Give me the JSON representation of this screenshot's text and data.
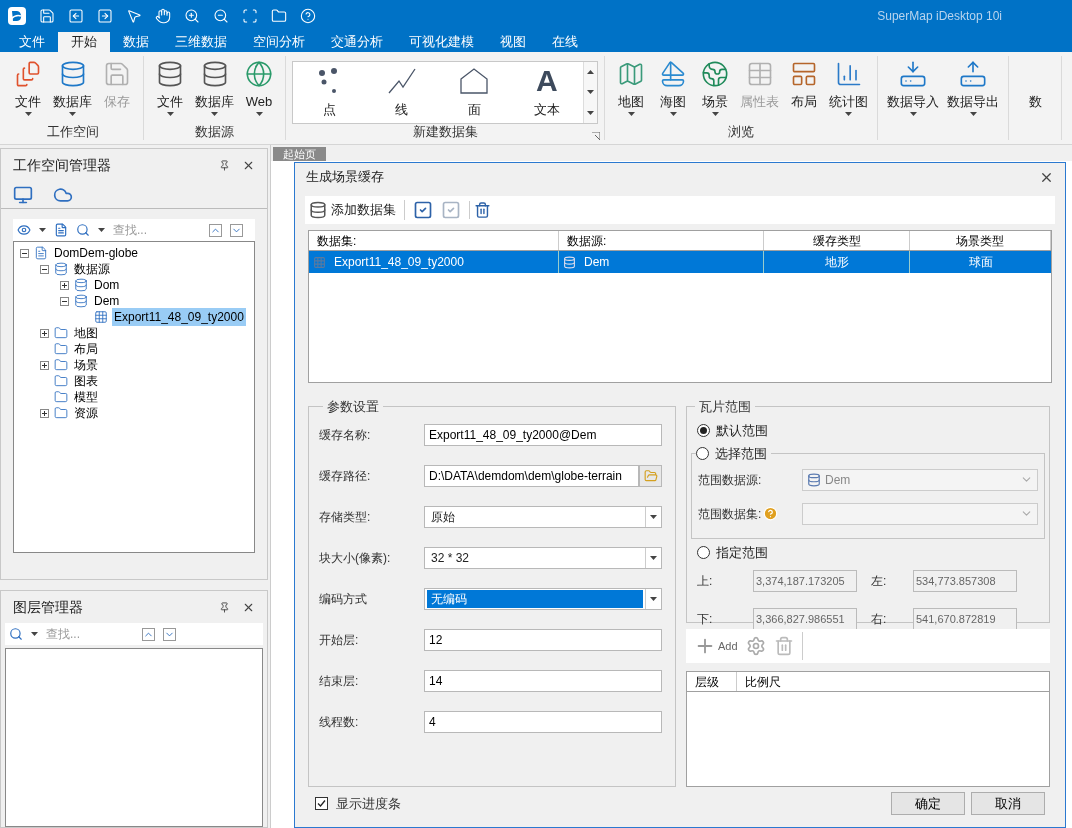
{
  "title_bar": {
    "app_title": "SuperMap iDesktop 10i"
  },
  "menu_tabs": [
    {
      "label": "文件",
      "selected": false
    },
    {
      "label": "开始",
      "selected": true
    },
    {
      "label": "数据",
      "selected": false
    },
    {
      "label": "三维数据",
      "selected": false
    },
    {
      "label": "空间分析",
      "selected": false
    },
    {
      "label": "交通分析",
      "selected": false
    },
    {
      "label": "可视化建模",
      "selected": false
    },
    {
      "label": "视图",
      "selected": false
    },
    {
      "label": "在线",
      "selected": false
    }
  ],
  "ribbon": {
    "groups": [
      {
        "kind": "buttons",
        "title": "工作空间",
        "buttons": [
          {
            "label": "文件",
            "dropdown": true,
            "disabled": false
          },
          {
            "label": "数据库",
            "dropdown": true,
            "disabled": false
          },
          {
            "label": "保存",
            "dropdown": false,
            "disabled": true
          }
        ]
      },
      {
        "kind": "buttons",
        "title": "数据源",
        "buttons": [
          {
            "label": "文件",
            "dropdown": true,
            "disabled": false
          },
          {
            "label": "数据库",
            "dropdown": true,
            "disabled": false
          },
          {
            "label": "Web",
            "dropdown": true,
            "disabled": false
          }
        ]
      },
      {
        "kind": "gallery",
        "title": "新建数据集",
        "items": [
          {
            "label": "点"
          },
          {
            "label": "线"
          },
          {
            "label": "面"
          },
          {
            "label": "文本",
            "glyph": "A"
          }
        ]
      },
      {
        "kind": "buttons",
        "title": "浏览",
        "buttons": [
          {
            "label": "地图",
            "dropdown": true,
            "disabled": false
          },
          {
            "label": "海图",
            "dropdown": true,
            "disabled": false
          },
          {
            "label": "场景",
            "dropdown": true,
            "disabled": false
          },
          {
            "label": "属性表",
            "dropdown": false,
            "disabled": true
          },
          {
            "label": "布局",
            "dropdown": false,
            "disabled": false
          },
          {
            "label": "统计图",
            "dropdown": true,
            "disabled": false
          }
        ]
      },
      {
        "kind": "buttons",
        "buttons": [
          {
            "label": "数据导入",
            "dropdown": true,
            "disabled": false
          },
          {
            "label": "数据导出",
            "dropdown": true,
            "disabled": false
          }
        ]
      },
      {
        "kind": "buttons",
        "buttons": [
          {
            "label": "数",
            "dropdown": false,
            "disabled": false
          }
        ]
      }
    ]
  },
  "workspace_manager": {
    "title": "工作空间管理器",
    "search": {
      "placeholder": "查找..."
    },
    "tree": [
      {
        "label": "DomDem-globe",
        "expanded": true,
        "selected": false,
        "children": [
          {
            "label": "数据源",
            "expanded": true,
            "selected": false,
            "children": [
              {
                "label": "Dom",
                "expanded": false,
                "selected": false
              },
              {
                "label": "Dem",
                "expanded": true,
                "selected": false,
                "children": [
                  {
                    "label": "Export11_48_09_ty2000",
                    "selected": true
                  }
                ]
              }
            ]
          },
          {
            "label": "地图",
            "expanded": false,
            "selected": false
          },
          {
            "label": "布局",
            "selected": false
          },
          {
            "label": "场景",
            "expanded": false,
            "selected": false
          },
          {
            "label": "图表",
            "selected": false
          },
          {
            "label": "模型",
            "selected": false
          },
          {
            "label": "资源",
            "expanded": false,
            "selected": false
          }
        ]
      }
    ]
  },
  "layer_manager": {
    "title": "图层管理器",
    "search": {
      "placeholder": "查找..."
    }
  },
  "document_tab": {
    "label": "起始页"
  },
  "dialog": {
    "title": "生成场景缓存",
    "add_dataset": "添加数据集",
    "table": {
      "columns": [
        "数据集:",
        "数据源:",
        "缓存类型",
        "场景类型"
      ],
      "rows": [
        {
          "dataset": "Export11_48_09_ty2000",
          "datasource": "Dem",
          "cache_type": "地形",
          "scene_type": "球面",
          "selected": true
        }
      ]
    },
    "params": {
      "title": "参数设置",
      "fields": [
        {
          "label": "缓存名称:",
          "kind": "text",
          "value": "Export11_48_09_ty2000@Dem",
          "highlighted": false
        },
        {
          "label": "缓存路径:",
          "kind": "path",
          "value": "D:\\DATA\\demdom\\dem\\globe-terrain",
          "highlighted": false
        },
        {
          "label": "存储类型:",
          "kind": "dropdown",
          "value": "原始",
          "highlighted": false
        },
        {
          "label": "块大小(像素):",
          "kind": "dropdown",
          "value": "32 * 32",
          "highlighted": false
        },
        {
          "label": "编码方式",
          "kind": "dropdown",
          "value": "无编码",
          "highlighted": true
        },
        {
          "label": "开始层:",
          "kind": "text",
          "value": "12",
          "highlighted": false
        },
        {
          "label": "结束层:",
          "kind": "text",
          "value": "14",
          "highlighted": false
        },
        {
          "label": "线程数:",
          "kind": "text",
          "value": "4",
          "highlighted": false
        }
      ]
    },
    "tile_range": {
      "title": "瓦片范围",
      "default_range": {
        "label": "默认范围",
        "selected": true
      },
      "select_range": {
        "label": "选择范围",
        "selected": false,
        "datasource_label": "范围数据源:",
        "datasource_value": "Dem",
        "dataset_label": "范围数据集:"
      },
      "custom_range": {
        "label": "指定范围",
        "selected": false
      },
      "bounds": [
        {
          "label": "上:",
          "value": "3,374,187.173205"
        },
        {
          "label": "左:",
          "value": "534,773.857308"
        },
        {
          "label": "下:",
          "value": "3,366,827.986551"
        },
        {
          "label": "右:",
          "value": "541,670.872819"
        }
      ]
    },
    "scale_toolbar": {
      "add": "Add"
    },
    "scale_table": {
      "columns": [
        "层级",
        "比例尺"
      ]
    },
    "show_progress": {
      "label": "显示进度条",
      "checked": true
    },
    "buttons": [
      "确定",
      "取消"
    ]
  }
}
